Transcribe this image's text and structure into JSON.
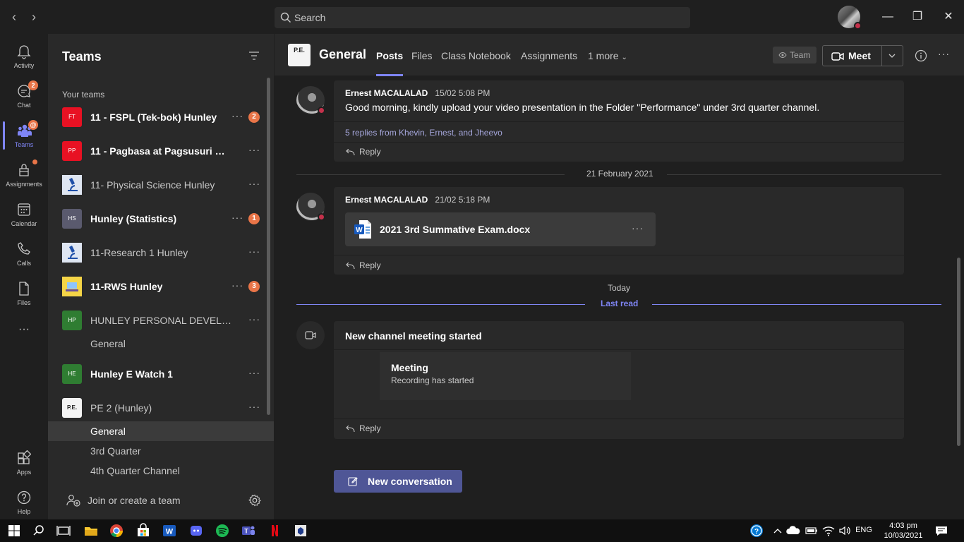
{
  "topbar": {
    "search_placeholder": "Search",
    "window_controls": {
      "minimize": "—",
      "maximize": "❐",
      "close": "✕"
    }
  },
  "rail": {
    "items": [
      {
        "label": "Activity",
        "icon": "bell-icon"
      },
      {
        "label": "Chat",
        "icon": "chat-icon",
        "badge": "2"
      },
      {
        "label": "Teams",
        "icon": "teams-icon",
        "badge": "@",
        "active": true
      },
      {
        "label": "Assignments",
        "icon": "assignments-icon",
        "dot": true
      },
      {
        "label": "Calendar",
        "icon": "calendar-icon"
      },
      {
        "label": "Calls",
        "icon": "phone-icon"
      },
      {
        "label": "Files",
        "icon": "file-icon"
      },
      {
        "label": "Apps",
        "icon": "apps-icon"
      },
      {
        "label": "Help",
        "icon": "help-icon"
      }
    ],
    "more": "···"
  },
  "teams_panel": {
    "title": "Teams",
    "section": "Your teams",
    "teams": [
      {
        "initials": "FT",
        "name": "11 - FSPL (Tek-bok) Hunley",
        "bold": true,
        "count": "2",
        "color": "#e81123"
      },
      {
        "initials": "PP",
        "name": "11 - Pagbasa at Pagsusuri Hu...",
        "bold": true,
        "color": "#e81123"
      },
      {
        "initials": "",
        "name": "11- Physical Science Hunley",
        "bold": false,
        "color": "#1e3a8a"
      },
      {
        "initials": "HS",
        "name": "Hunley (Statistics)",
        "bold": true,
        "count": "1",
        "color": "#5a5a6e"
      },
      {
        "initials": "",
        "name": "11-Research 1 Hunley",
        "bold": false,
        "color": "#1e3a8a"
      },
      {
        "initials": "",
        "name": "11-RWS Hunley",
        "bold": true,
        "count": "3",
        "color": "#f5d547"
      },
      {
        "initials": "HP",
        "name": "HUNLEY PERSONAL DEVELOP...",
        "bold": false,
        "color": "#2f7d32"
      },
      {
        "initials": "HE",
        "name": "Hunley E Watch 1",
        "bold": true,
        "color": "#2f7d32"
      },
      {
        "initials": "",
        "name": "PE 2 (Hunley)",
        "bold": false,
        "color": "#f4f4f4"
      }
    ],
    "channels": {
      "hunley_pd_general": "General",
      "pe2": [
        "General",
        "3rd Quarter",
        "4th Quarter Channel"
      ]
    },
    "join_label": "Join or create a team",
    "more": "···"
  },
  "channel": {
    "logo_text": "P.E.",
    "title": "General",
    "tabs": [
      "Posts",
      "Files",
      "Class Notebook",
      "Assignments",
      "1 more"
    ],
    "team_button": "Team",
    "meet_button": "Meet",
    "more": "···"
  },
  "feed": {
    "post1": {
      "author": "Ernest MACALALAD",
      "time": "15/02 5:08 PM",
      "body": "Good morning, kindly upload your video presentation in the Folder \"Performance\" under 3rd quarter channel.",
      "replies": "5 replies from Khevin, Ernest, and Jheevo",
      "reply": "Reply"
    },
    "date_sep_1": "21 February 2021",
    "post2": {
      "author": "Ernest MACALALAD",
      "time": "21/02 5:18 PM",
      "file_name": "2021 3rd Summative Exam.docx",
      "file_more": "···",
      "reply": "Reply"
    },
    "date_sep_2": "Today",
    "last_read": "Last read",
    "post3": {
      "title": "New channel meeting started",
      "meeting_title": "Meeting",
      "meeting_status": "Recording has started",
      "reply": "Reply"
    },
    "new_conversation": "New conversation"
  },
  "taskbar": {
    "language": "ENG",
    "time": "4:03 pm",
    "date": "10/03/2021"
  },
  "colors": {
    "accent": "#7f85f5",
    "badge": "#e97548",
    "busy": "#c4314b",
    "background": "#1f1f1f",
    "panel": "#292929"
  }
}
